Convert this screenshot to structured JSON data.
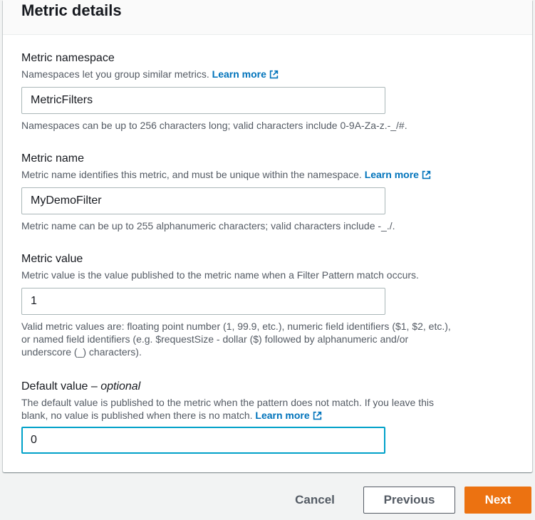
{
  "panel": {
    "title": "Metric details"
  },
  "namespace": {
    "label": "Metric namespace",
    "description": "Namespaces let you group similar metrics.",
    "link": "Learn more",
    "value": "MetricFilters",
    "constraint": "Namespaces can be up to 256 characters long; valid characters include 0-9A-Za-z.-_/#."
  },
  "metric_name": {
    "label": "Metric name",
    "description": "Metric name identifies this metric, and must be unique within the namespace.",
    "link": "Learn more",
    "value": "MyDemoFilter",
    "constraint": "Metric name can be up to 255 alphanumeric characters; valid characters include -_./."
  },
  "metric_value": {
    "label": "Metric value",
    "description": "Metric value is the value published to the metric name when a Filter Pattern match occurs.",
    "value": "1",
    "constraint_lines": [
      "Valid metric values are: floating point number (1, 99.9, etc.), numeric field identifiers ($1, $2, etc.),",
      "or named field identifiers (e.g. $requestSize - dollar ($) followed by alphanumeric and/or",
      "underscore (_) characters)."
    ]
  },
  "default_value": {
    "label": "Default value",
    "label_sep": " – ",
    "optional": "optional",
    "description_lines": [
      "The default value is published to the metric when the pattern does not match. If you leave this",
      "blank, no value is published when there is no match."
    ],
    "link": "Learn more",
    "value": "0"
  },
  "footer": {
    "cancel": "Cancel",
    "previous": "Previous",
    "next": "Next"
  },
  "colors": {
    "link": "#0073bb",
    "primary": "#ec7211",
    "focus": "#00a1c9",
    "muted": "#545b64"
  },
  "icons": {
    "external_link": "external-link-icon"
  }
}
